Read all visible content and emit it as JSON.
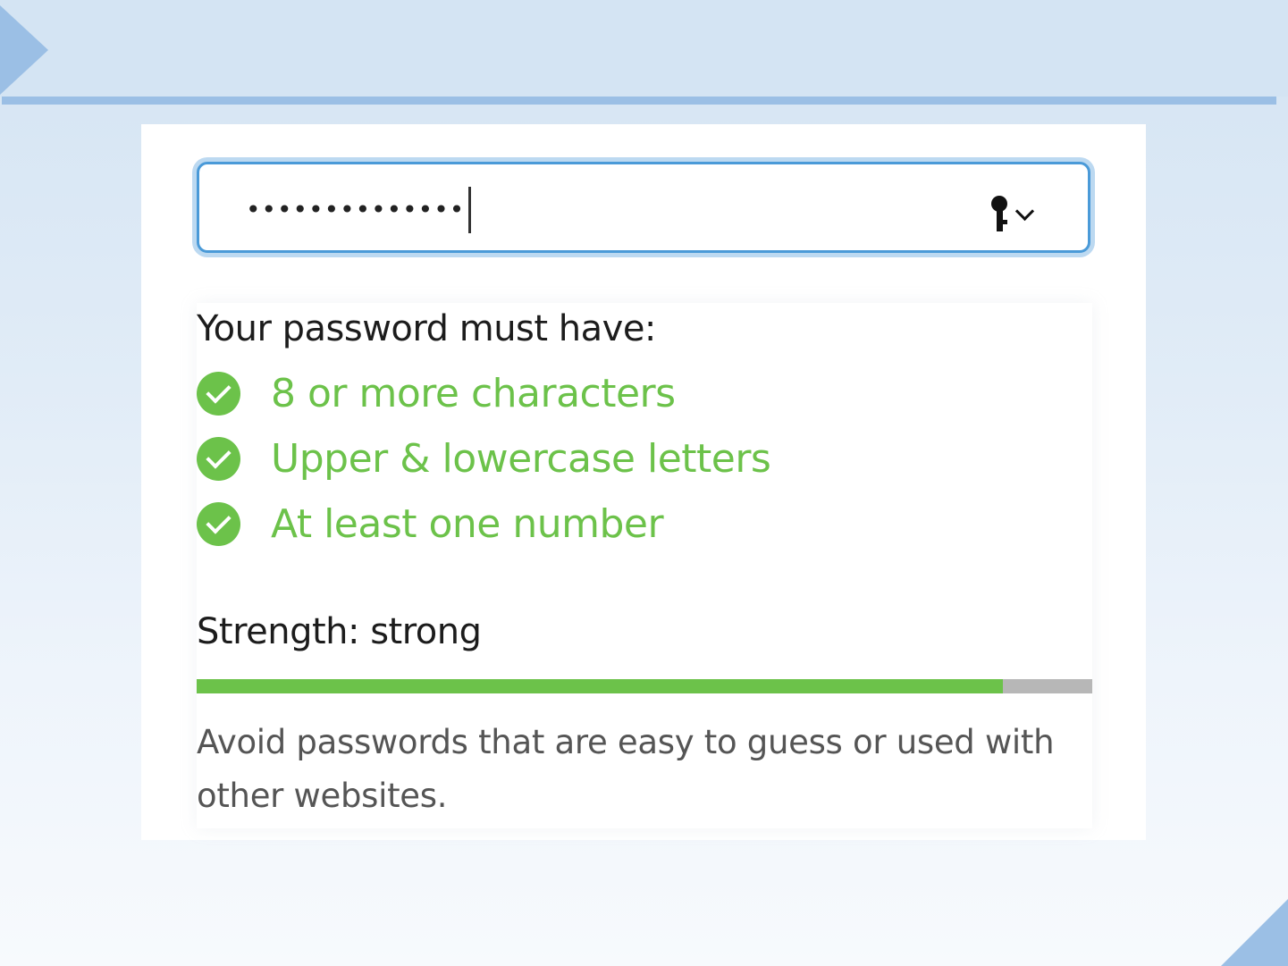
{
  "password_field": {
    "masked_value": "••••••••••••••",
    "key_icon": "key-icon",
    "menu_icon": "chevron-down-icon"
  },
  "requirements": {
    "title": "Your password must have:",
    "items": [
      {
        "label": "8 or more characters",
        "met": true,
        "icon": "check-circle-icon"
      },
      {
        "label": "Upper & lowercase letters",
        "met": true,
        "icon": "check-circle-icon"
      },
      {
        "label": "At least one number",
        "met": true,
        "icon": "check-circle-icon"
      }
    ]
  },
  "strength": {
    "label": "Strength: strong",
    "level": 0.9
  },
  "hint": "Avoid passwords that are easy to guess or used with other websites.",
  "colors": {
    "accent": "#4a9ad8",
    "success": "#6cc24a",
    "header": "#d4e4f3",
    "header_line": "#9bbfe5"
  }
}
